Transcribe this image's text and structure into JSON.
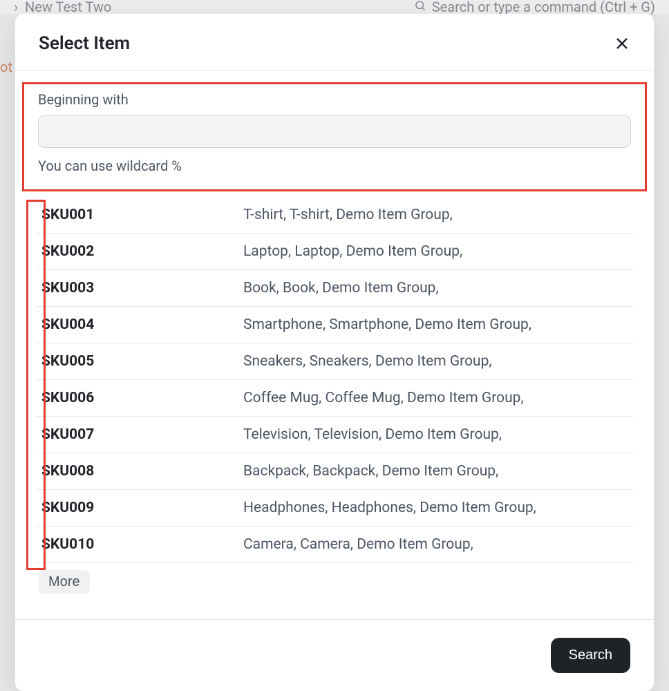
{
  "background": {
    "breadcrumb_title": "New Test Two",
    "search_placeholder": "Search or type a command (Ctrl + G)",
    "left_partial": "ot"
  },
  "modal": {
    "title": "Select Item",
    "filter": {
      "label": "Beginning with",
      "value": "",
      "help": "You can use wildcard %"
    },
    "results": [
      {
        "sku": "SKU001",
        "desc": "T-shirt, T-shirt, Demo Item Group,"
      },
      {
        "sku": "SKU002",
        "desc": "Laptop, Laptop, Demo Item Group,"
      },
      {
        "sku": "SKU003",
        "desc": "Book, Book, Demo Item Group,"
      },
      {
        "sku": "SKU004",
        "desc": "Smartphone, Smartphone, Demo Item Group,"
      },
      {
        "sku": "SKU005",
        "desc": "Sneakers, Sneakers, Demo Item Group,"
      },
      {
        "sku": "SKU006",
        "desc": "Coffee Mug, Coffee Mug, Demo Item Group,"
      },
      {
        "sku": "SKU007",
        "desc": "Television, Television, Demo Item Group,"
      },
      {
        "sku": "SKU008",
        "desc": "Backpack, Backpack, Demo Item Group,"
      },
      {
        "sku": "SKU009",
        "desc": "Headphones, Headphones, Demo Item Group,"
      },
      {
        "sku": "SKU010",
        "desc": "Camera, Camera, Demo Item Group,"
      }
    ],
    "more_label": "More",
    "search_label": "Search"
  }
}
